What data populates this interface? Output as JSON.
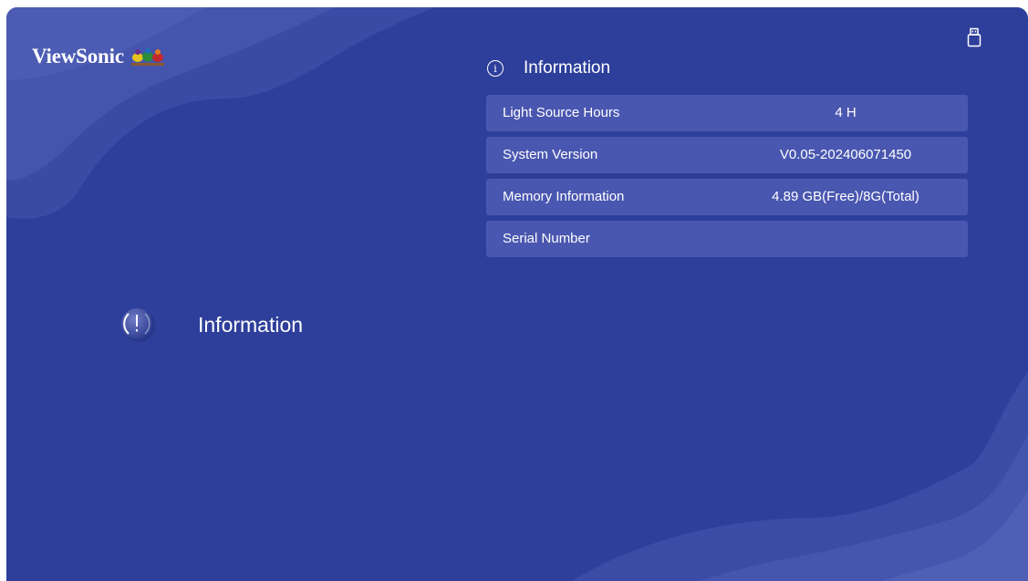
{
  "brand": {
    "name": "ViewSonic"
  },
  "status": {
    "usb_icon": "usb-drive-icon"
  },
  "sidebar": {
    "label": "Information",
    "icon": "info-alert-icon"
  },
  "panel": {
    "title": "Information",
    "title_icon": "info-circle-icon",
    "rows": [
      {
        "label": "Light Source Hours",
        "value": "4 H"
      },
      {
        "label": "System Version",
        "value": "V0.05-202406071450"
      },
      {
        "label": "Memory Information",
        "value": "4.89 GB(Free)/8G(Total)"
      },
      {
        "label": "Serial Number",
        "value": ""
      }
    ]
  },
  "colors": {
    "background": "#2e3f9b",
    "row_background": "#4a57b0",
    "text": "#ffffff"
  }
}
